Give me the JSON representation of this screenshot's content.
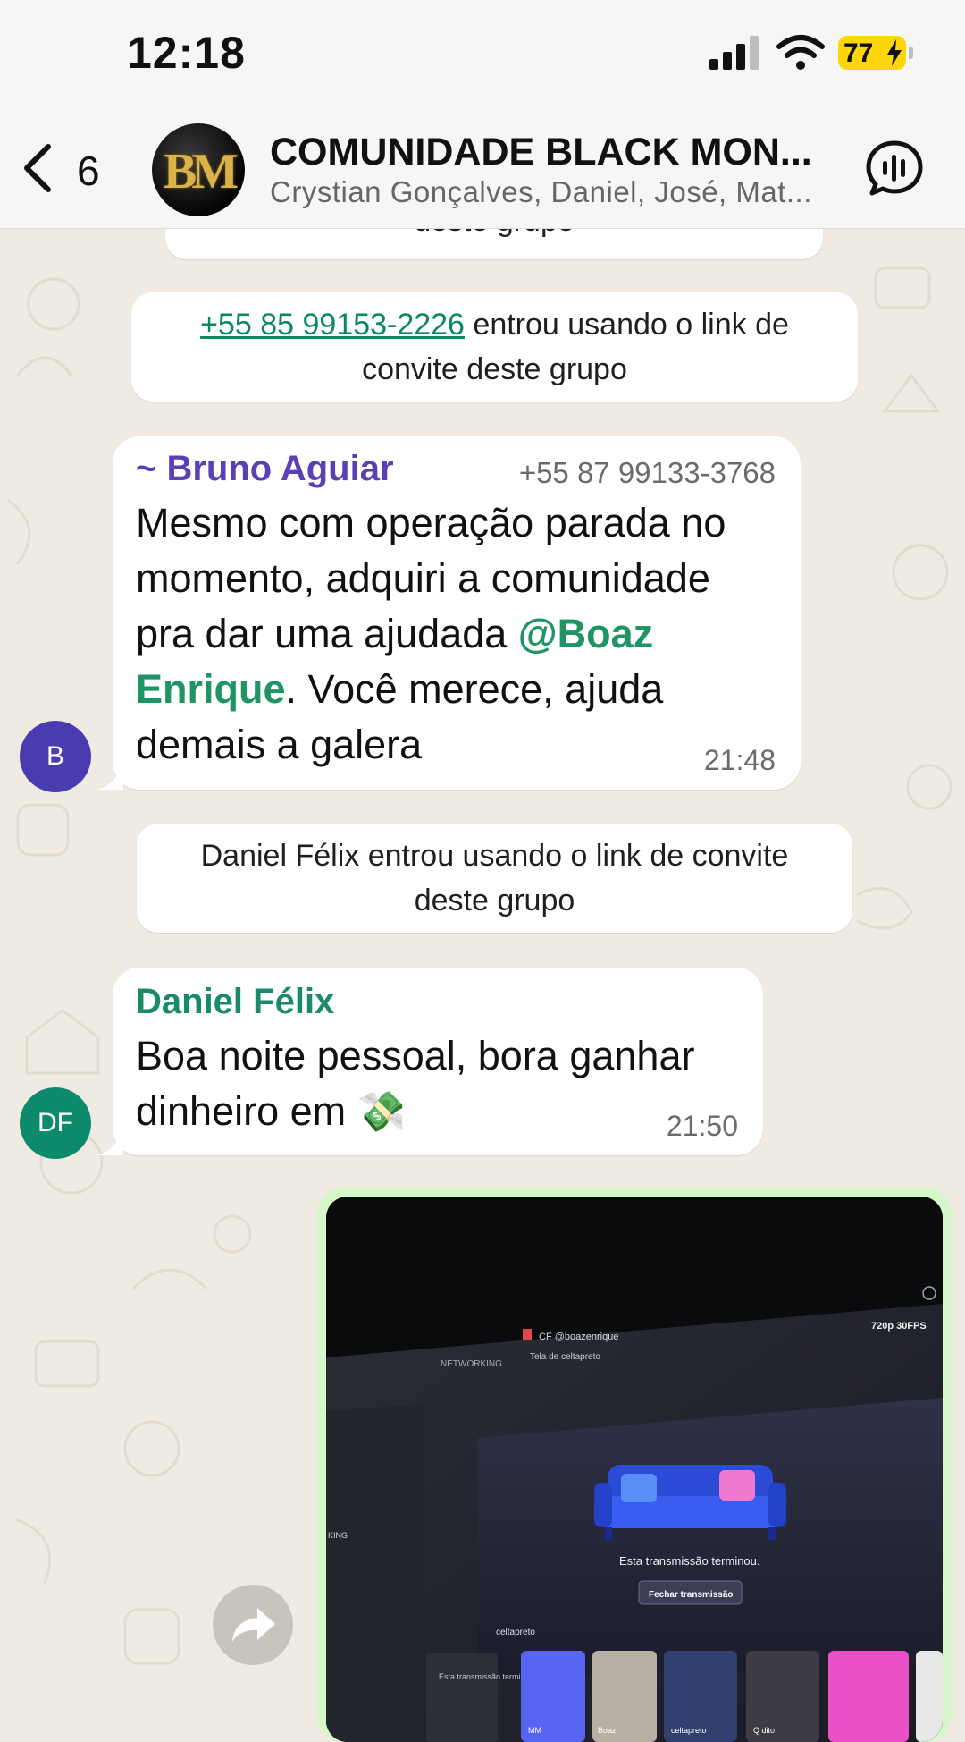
{
  "status_bar": {
    "time": "12:18",
    "battery_level": "77",
    "icons": [
      "signal-icon",
      "wifi-icon",
      "battery-charging-icon"
    ]
  },
  "header": {
    "back_count": "6",
    "group_avatar_text": "BM",
    "title": "COMUNIDADE BLACK MON...",
    "members": "Crystian Gonçalves, Daniel, José, Mat...",
    "icons": [
      "chevron-left-icon",
      "voice-chat-icon"
    ]
  },
  "chat": {
    "system_partial": "deste grupo",
    "system_join1": {
      "phone": "+55 85 99153-2226",
      "text_line1": " entrou usando o link de",
      "text_line2": "convite deste grupo"
    },
    "message1": {
      "sender": "~ Bruno Aguiar",
      "sender_phone": "+55 87 99133-3768",
      "line1": "Mesmo com operação parada no",
      "line2": "momento, adquiri a comunidade",
      "line3_pre": "pra dar uma ajudada ",
      "mention_part1": "@Boaz",
      "mention_part2": "Enrique",
      "line4_post": ". Você merece, ajuda",
      "line5": "demais a galera",
      "time": "21:48",
      "avatar_initials": "B"
    },
    "system_join2": {
      "line1": "Daniel Félix entrou usando o link de convite",
      "line2": "deste grupo"
    },
    "message2": {
      "sender": "Daniel Félix",
      "line1": "Boa noite pessoal, bora ganhar",
      "line2": "dinheiro em ",
      "emoji": "💸",
      "time": "21:50",
      "avatar_initials": "DF"
    },
    "media_message": {
      "stream_user": "CF @boazenrique",
      "quality": "720p 30FPS",
      "breadcrumb_channel": "NETWORKING",
      "breadcrumb_screen": "Tela de celtapreto",
      "ended_text": "Esta transmissão terminou.",
      "close_button": "Fechar transmissão",
      "streamer_label": "celtapreto",
      "sidebar_channel": "KING",
      "sidebar_status": "Esta transmissão terminou.",
      "tile_labels": [
        "MM",
        "Boaz",
        "celtapreto",
        "Q dito"
      ]
    },
    "colors": {
      "bruno_name": "#5a3fb5",
      "daniel_name": "#1a8a6a",
      "bruno_avatar": "#4b3bb1",
      "daniel_avatar": "#0d8a6c",
      "mention": "#1f9565",
      "outgoing_bubble": "#d6f8c8"
    }
  }
}
